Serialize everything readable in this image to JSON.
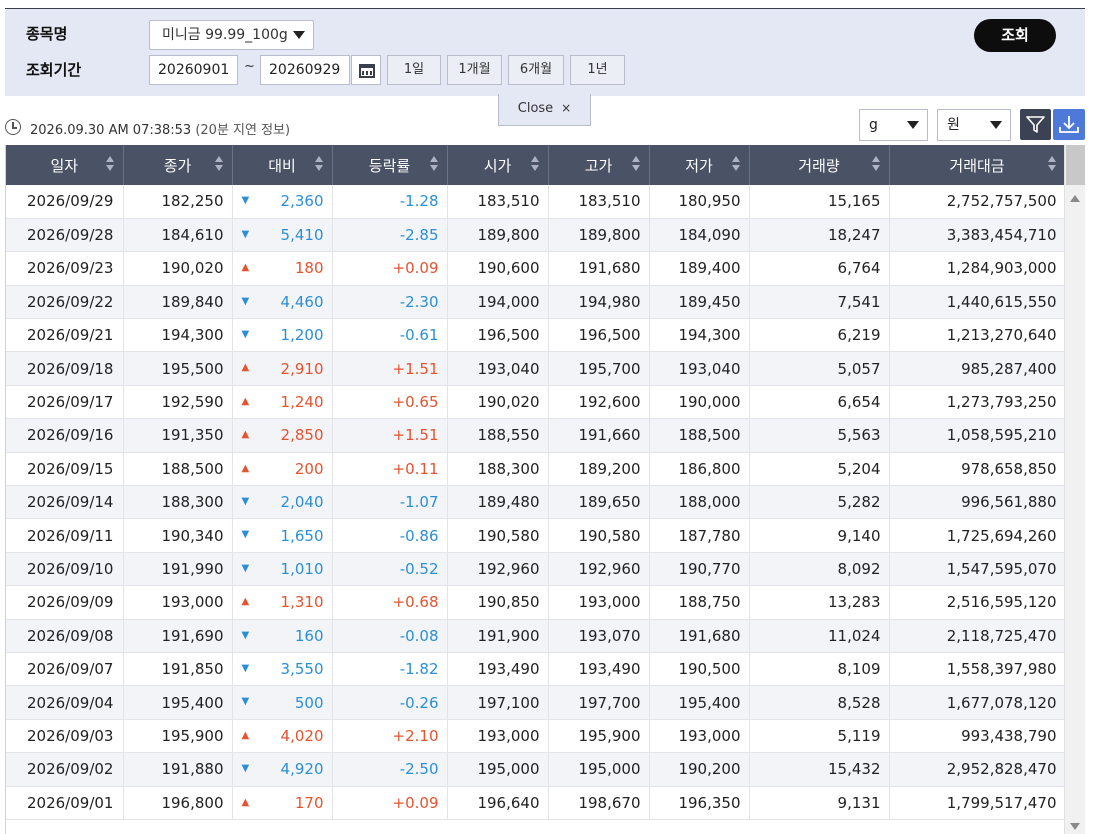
{
  "search": {
    "item_label": "종목명",
    "item_value": "미니금 99.99_100g",
    "period_label": "조회기간",
    "date_from": "20260901",
    "tilde": "~",
    "date_to": "20260929",
    "period_buttons": [
      "1일",
      "1개월",
      "6개월",
      "1년"
    ],
    "search_button": "조회",
    "close_label": "Close",
    "close_glyph": "×"
  },
  "info": {
    "timestamp": "2026.09.30 AM 07:38:53",
    "delay_note": "(20분 지연 정보)",
    "unit_weight": "g",
    "unit_currency": "원"
  },
  "colors": {
    "up": "#e3542f",
    "down": "#2c8fd3",
    "header_bg": "#4a5266",
    "download_bg": "#4f79d8"
  },
  "table": {
    "columns": [
      "일자",
      "종가",
      "대비",
      "등락률",
      "시가",
      "고가",
      "저가",
      "거래량",
      "거래대금"
    ],
    "rows": [
      {
        "date": "2026/09/29",
        "close": "182,250",
        "dir": "down",
        "chg": "2,360",
        "rate": "-1.28",
        "open": "183,510",
        "high": "183,510",
        "low": "180,950",
        "vol": "15,165",
        "amt": "2,752,757,500"
      },
      {
        "date": "2026/09/28",
        "close": "184,610",
        "dir": "down",
        "chg": "5,410",
        "rate": "-2.85",
        "open": "189,800",
        "high": "189,800",
        "low": "184,090",
        "vol": "18,247",
        "amt": "3,383,454,710"
      },
      {
        "date": "2026/09/23",
        "close": "190,020",
        "dir": "up",
        "chg": "180",
        "rate": "+0.09",
        "open": "190,600",
        "high": "191,680",
        "low": "189,400",
        "vol": "6,764",
        "amt": "1,284,903,000"
      },
      {
        "date": "2026/09/22",
        "close": "189,840",
        "dir": "down",
        "chg": "4,460",
        "rate": "-2.30",
        "open": "194,000",
        "high": "194,980",
        "low": "189,450",
        "vol": "7,541",
        "amt": "1,440,615,550"
      },
      {
        "date": "2026/09/21",
        "close": "194,300",
        "dir": "down",
        "chg": "1,200",
        "rate": "-0.61",
        "open": "196,500",
        "high": "196,500",
        "low": "194,300",
        "vol": "6,219",
        "amt": "1,213,270,640"
      },
      {
        "date": "2026/09/18",
        "close": "195,500",
        "dir": "up",
        "chg": "2,910",
        "rate": "+1.51",
        "open": "193,040",
        "high": "195,700",
        "low": "193,040",
        "vol": "5,057",
        "amt": "985,287,400"
      },
      {
        "date": "2026/09/17",
        "close": "192,590",
        "dir": "up",
        "chg": "1,240",
        "rate": "+0.65",
        "open": "190,020",
        "high": "192,600",
        "low": "190,000",
        "vol": "6,654",
        "amt": "1,273,793,250"
      },
      {
        "date": "2026/09/16",
        "close": "191,350",
        "dir": "up",
        "chg": "2,850",
        "rate": "+1.51",
        "open": "188,550",
        "high": "191,660",
        "low": "188,500",
        "vol": "5,563",
        "amt": "1,058,595,210"
      },
      {
        "date": "2026/09/15",
        "close": "188,500",
        "dir": "up",
        "chg": "200",
        "rate": "+0.11",
        "open": "188,300",
        "high": "189,200",
        "low": "186,800",
        "vol": "5,204",
        "amt": "978,658,850"
      },
      {
        "date": "2026/09/14",
        "close": "188,300",
        "dir": "down",
        "chg": "2,040",
        "rate": "-1.07",
        "open": "189,480",
        "high": "189,650",
        "low": "188,000",
        "vol": "5,282",
        "amt": "996,561,880"
      },
      {
        "date": "2026/09/11",
        "close": "190,340",
        "dir": "down",
        "chg": "1,650",
        "rate": "-0.86",
        "open": "190,580",
        "high": "190,580",
        "low": "187,780",
        "vol": "9,140",
        "amt": "1,725,694,260"
      },
      {
        "date": "2026/09/10",
        "close": "191,990",
        "dir": "down",
        "chg": "1,010",
        "rate": "-0.52",
        "open": "192,960",
        "high": "192,960",
        "low": "190,770",
        "vol": "8,092",
        "amt": "1,547,595,070"
      },
      {
        "date": "2026/09/09",
        "close": "193,000",
        "dir": "up",
        "chg": "1,310",
        "rate": "+0.68",
        "open": "190,850",
        "high": "193,000",
        "low": "188,750",
        "vol": "13,283",
        "amt": "2,516,595,120"
      },
      {
        "date": "2026/09/08",
        "close": "191,690",
        "dir": "down",
        "chg": "160",
        "rate": "-0.08",
        "open": "191,900",
        "high": "193,070",
        "low": "191,680",
        "vol": "11,024",
        "amt": "2,118,725,470"
      },
      {
        "date": "2026/09/07",
        "close": "191,850",
        "dir": "down",
        "chg": "3,550",
        "rate": "-1.82",
        "open": "193,490",
        "high": "193,490",
        "low": "190,500",
        "vol": "8,109",
        "amt": "1,558,397,980"
      },
      {
        "date": "2026/09/04",
        "close": "195,400",
        "dir": "down",
        "chg": "500",
        "rate": "-0.26",
        "open": "197,100",
        "high": "197,700",
        "low": "195,400",
        "vol": "8,528",
        "amt": "1,677,078,120"
      },
      {
        "date": "2026/09/03",
        "close": "195,900",
        "dir": "up",
        "chg": "4,020",
        "rate": "+2.10",
        "open": "193,000",
        "high": "195,900",
        "low": "193,000",
        "vol": "5,119",
        "amt": "993,438,790"
      },
      {
        "date": "2026/09/02",
        "close": "191,880",
        "dir": "down",
        "chg": "4,920",
        "rate": "-2.50",
        "open": "195,000",
        "high": "195,000",
        "low": "190,200",
        "vol": "15,432",
        "amt": "2,952,828,470"
      },
      {
        "date": "2026/09/01",
        "close": "196,800",
        "dir": "up",
        "chg": "170",
        "rate": "+0.09",
        "open": "196,640",
        "high": "198,670",
        "low": "196,350",
        "vol": "9,131",
        "amt": "1,799,517,470"
      }
    ]
  }
}
